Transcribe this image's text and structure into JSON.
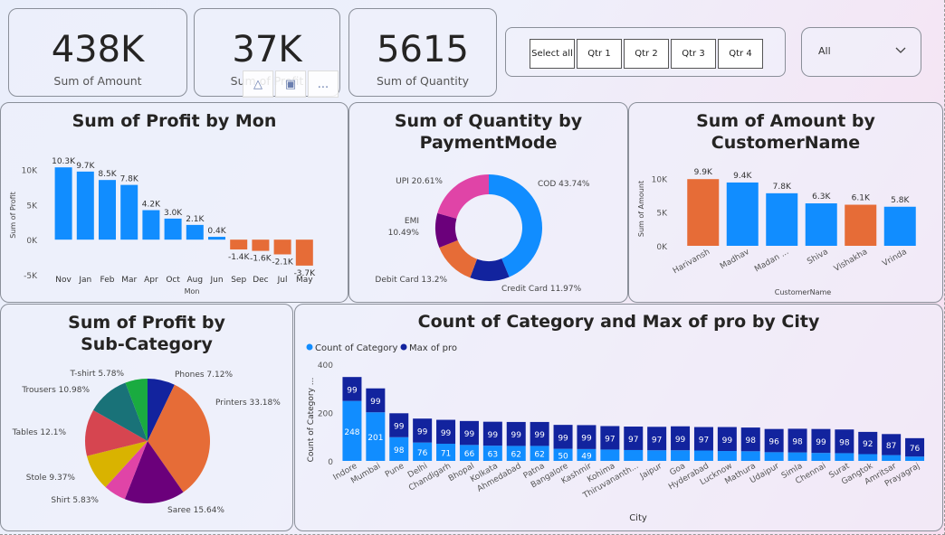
{
  "kpis": [
    {
      "value": "438K",
      "label": "Sum of Amount"
    },
    {
      "value": "37K",
      "label": "Sum of Profit"
    },
    {
      "value": "5615",
      "label": "Sum of Quantity"
    }
  ],
  "quarters": [
    "Select all",
    "Qtr 1",
    "Qtr 2",
    "Qtr 3",
    "Qtr 4"
  ],
  "dropdown": {
    "value": "All"
  },
  "toolbar": {
    "more": "..."
  },
  "chart_data": [
    {
      "type": "bar",
      "title": "Sum of Profit by Mon",
      "xlabel": "Mon",
      "ylabel": "Sum of Profit",
      "ylim": [
        -5000,
        12000
      ],
      "ticks": [
        {
          "v": 10000,
          "l": "10K"
        },
        {
          "v": 5000,
          "l": "5K"
        },
        {
          "v": 0,
          "l": "0K"
        },
        {
          "v": -5000,
          "l": "-5K"
        }
      ],
      "categories": [
        "Nov",
        "Jan",
        "Feb",
        "Mar",
        "Apr",
        "Oct",
        "Aug",
        "Jun",
        "Sep",
        "Dec",
        "Jul",
        "May"
      ],
      "values": [
        10300,
        9700,
        8500,
        7800,
        4200,
        3000,
        2100,
        400,
        -1400,
        -1600,
        -2100,
        -3700
      ],
      "labels": [
        "10.3K",
        "9.7K",
        "8.5K",
        "7.8K",
        "4.2K",
        "3.0K",
        "2.1K",
        "0.4K",
        "-1.4K",
        "-1.6K",
        "-2.1K",
        "-3.7K"
      ],
      "colors": {
        "positive": "#118dff",
        "negative": "#e66c37"
      }
    },
    {
      "type": "pie",
      "donut": true,
      "title": "Sum of Quantity by PaymentMode",
      "slices": [
        {
          "name": "COD",
          "value": 43.74,
          "label": "COD 43.74%",
          "color": "#118dff"
        },
        {
          "name": "Credit Card",
          "value": 11.97,
          "label": "Credit Card 11.97%",
          "color": "#12239e"
        },
        {
          "name": "Debit Card",
          "value": 13.2,
          "label": "Debit Card 13.2%",
          "color": "#e66c37"
        },
        {
          "name": "EMI",
          "value": 10.49,
          "label1": "EMI",
          "label2": "10.49%",
          "color": "#6b007b"
        },
        {
          "name": "UPI",
          "value": 20.61,
          "label": "UPI 20.61%",
          "color": "#e044a7"
        }
      ]
    },
    {
      "type": "bar",
      "title": "Sum of Amount by CustomerName",
      "xlabel": "CustomerName",
      "ylabel": "Sum of Amount",
      "ylim": [
        0,
        11000
      ],
      "ticks": [
        {
          "v": 10000,
          "l": "10K"
        },
        {
          "v": 5000,
          "l": "5K"
        },
        {
          "v": 0,
          "l": "0K"
        }
      ],
      "categories": [
        "Harivansh",
        "Madhav",
        "Madan ...",
        "Shiva",
        "Vishakha",
        "Vrinda"
      ],
      "values": [
        9900,
        9400,
        7800,
        6300,
        6100,
        5800
      ],
      "labels": [
        "9.9K",
        "9.4K",
        "7.8K",
        "6.3K",
        "6.1K",
        "5.8K"
      ],
      "colors": [
        "#e66c37",
        "#118dff",
        "#118dff",
        "#118dff",
        "#e66c37",
        "#118dff"
      ]
    },
    {
      "type": "pie",
      "title": "Sum of Profit by Sub-Category",
      "slices": [
        {
          "name": "Phones",
          "value": 7.12,
          "label": "Phones 7.12%",
          "color": "#12239e"
        },
        {
          "name": "Printers",
          "value": 33.18,
          "label": "Printers 33.18%",
          "color": "#e66c37"
        },
        {
          "name": "Saree",
          "value": 15.64,
          "label": "Saree 15.64%",
          "color": "#6b007b"
        },
        {
          "name": "Shirt",
          "value": 5.83,
          "label": "Shirt 5.83%",
          "color": "#e044a7"
        },
        {
          "name": "Stole",
          "value": 9.37,
          "label": "Stole 9.37%",
          "color": "#d9b300"
        },
        {
          "name": "Tables",
          "value": 12.1,
          "label": "Tables 12.1%",
          "color": "#d64550"
        },
        {
          "name": "Trousers",
          "value": 10.98,
          "label": "Trousers 10.98%",
          "color": "#197278"
        },
        {
          "name": "T-shirt",
          "value": 5.78,
          "label": "T-shirt 5.78%",
          "color": "#1aab40"
        }
      ]
    },
    {
      "type": "bar",
      "title": "Count of Category and Max of pro by City",
      "xlabel": "City",
      "ylabel": "Count of Category ...",
      "ylim": [
        0,
        400
      ],
      "ticks": [
        {
          "v": 400,
          "l": "400"
        },
        {
          "v": 200,
          "l": "200"
        },
        {
          "v": 0,
          "l": "0"
        }
      ],
      "stacked": true,
      "categories": [
        "Indore",
        "Mumbai",
        "Pune",
        "Delhi",
        "Chandigarh",
        "Bhopal",
        "Kolkata",
        "Ahmedabad",
        "Patna",
        "Bangalore",
        "Kashmir",
        "Kohima",
        "Thiruvananth...",
        "Jaipur",
        "Goa",
        "Hyderabad",
        "Lucknow",
        "Mathura",
        "Udaipur",
        "Simla",
        "Chennai",
        "Surat",
        "Gangtok",
        "Amritsar",
        "Prayagraj"
      ],
      "series": [
        {
          "name": "Count of Category",
          "color": "#118dff",
          "values": [
            248,
            201,
            98,
            76,
            71,
            66,
            63,
            62,
            62,
            50,
            49,
            47,
            45,
            44,
            44,
            43,
            41,
            40,
            36,
            35,
            33,
            32,
            28,
            24,
            18
          ],
          "labels": [
            "248",
            "201",
            "98",
            "76",
            "71",
            "66",
            "63",
            "62",
            "62",
            "50",
            "49",
            "",
            "",
            "",
            "",
            "",
            "",
            "",
            "",
            "",
            "",
            "",
            "",
            "",
            ""
          ]
        },
        {
          "name": "Max of pro",
          "color": "#12239e",
          "values": [
            99,
            99,
            99,
            99,
            99,
            99,
            99,
            99,
            99,
            99,
            99,
            97,
            97,
            97,
            99,
            97,
            99,
            98,
            96,
            98,
            99,
            98,
            92,
            87,
            76
          ],
          "labels": [
            "99",
            "99",
            "99",
            "99",
            "99",
            "99",
            "99",
            "99",
            "99",
            "99",
            "99",
            "97",
            "97",
            "97",
            "99",
            "97",
            "99",
            "98",
            "96",
            "98",
            "99",
            "98",
            "92",
            "87",
            "76"
          ]
        }
      ]
    }
  ]
}
